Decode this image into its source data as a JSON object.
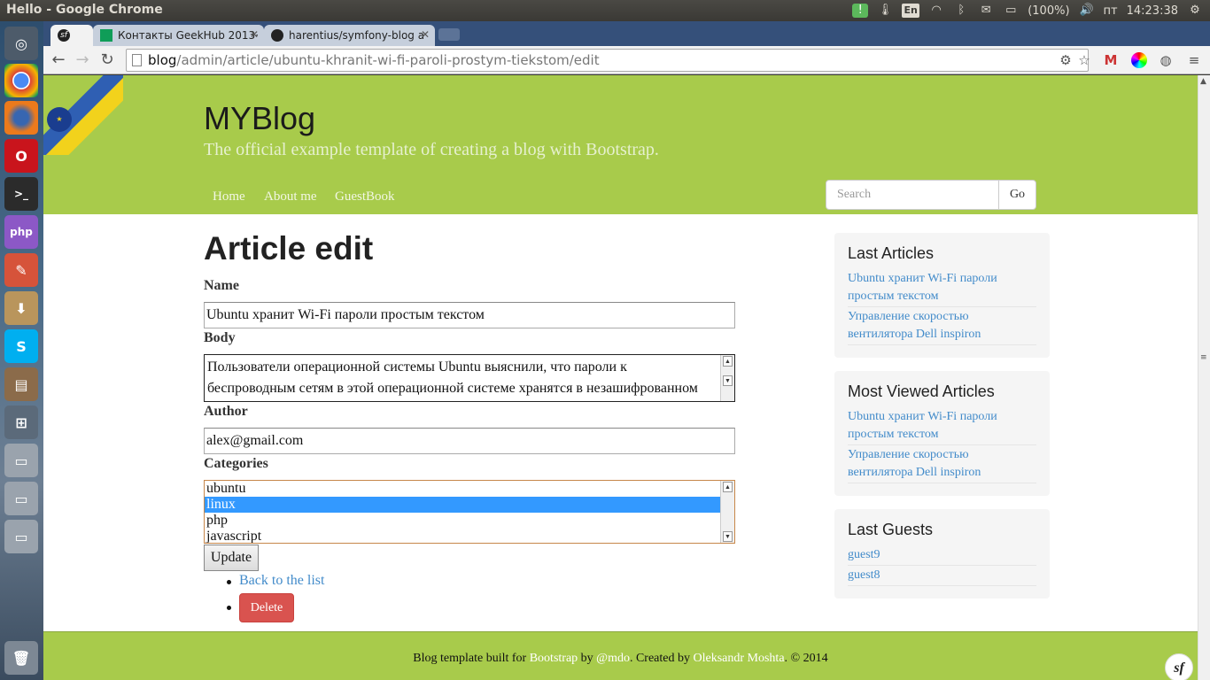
{
  "window": {
    "title": "Hello - Google Chrome"
  },
  "tray": {
    "lang": "En",
    "battery": "(100%)",
    "day": "пт",
    "time": "14:23:38"
  },
  "tabs": [
    {
      "label": "",
      "icon": "symfony-icon",
      "active": true
    },
    {
      "label": "Контакты GeekHub 2013·",
      "icon": "sheets-icon"
    },
    {
      "label": "harentius/symfony-blog a",
      "icon": "github-icon"
    }
  ],
  "omnibox": {
    "host": "blog",
    "path": "/admin/article/ubuntu-khranit-wi-fi-paroli-prostym-tiekstom/edit"
  },
  "header": {
    "title": "MYBlog",
    "description": "The official example template of creating a blog with Bootstrap.",
    "nav": [
      "Home",
      "About me",
      "GuestBook"
    ],
    "search_placeholder": "Search",
    "search_button": "Go"
  },
  "form": {
    "page_title": "Article edit",
    "name_label": "Name",
    "name_value": "Ubuntu хранит Wi-Fi пароли простым текстом",
    "body_label": "Body",
    "body_value": "Пользователи операционной системы Ubuntu выяснили, что пароли к беспроводным сетям в этой операционной системе хранятся в незашифрованном",
    "author_label": "Author",
    "author_value": "alex@gmail.com",
    "categories_label": "Categories",
    "categories": [
      "ubuntu",
      "linux",
      "php",
      "javascript"
    ],
    "selected_category": "linux",
    "update_button": "Update",
    "back_link": "Back to the list",
    "delete_button": "Delete"
  },
  "sidebar": {
    "last_articles": {
      "title": "Last Articles",
      "items": [
        "Ubuntu хранит Wi-Fi пароли простым текстом",
        "Управление скоростью вентилятора Dell inspiron"
      ]
    },
    "most_viewed": {
      "title": "Most Viewed Articles",
      "items": [
        "Ubuntu хранит Wi-Fi пароли простым текстом",
        "Управление скоростью вентилятора Dell inspiron"
      ]
    },
    "last_guests": {
      "title": "Last Guests",
      "items": [
        "guest9",
        "guest8"
      ]
    }
  },
  "footer": {
    "prefix": "Blog template built for ",
    "bootstrap": "Bootstrap",
    "by": " by ",
    "mdo": "@mdo",
    "created": ". Created by ",
    "author": "Oleksandr Moshta",
    "suffix": ". © 2014"
  },
  "colors": {
    "header_green": "#a8cb4b",
    "link_blue": "#428bca",
    "delete_red": "#d9534f",
    "select_blue": "#3399ff"
  }
}
